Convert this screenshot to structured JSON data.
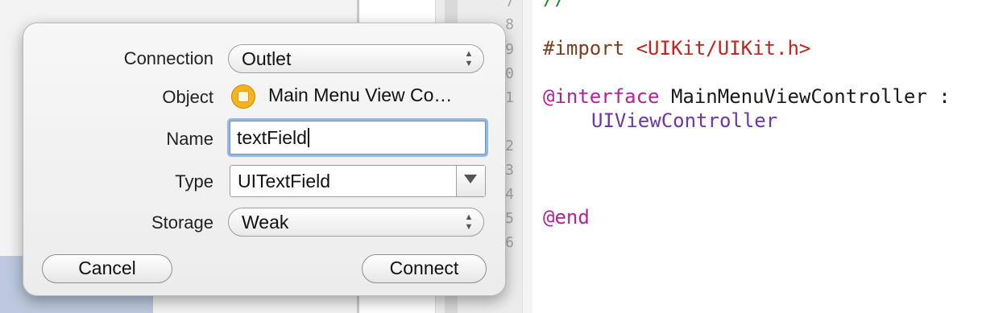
{
  "editor": {
    "line_numbers": [
      "7",
      "8",
      "9",
      "0",
      "1",
      "2",
      "3",
      "4",
      "5",
      "6"
    ],
    "code": {
      "comment": "//",
      "import_keyword": "#import",
      "import_path": "<UIKit/UIKit.h>",
      "interface_keyword": "@interface",
      "class_decl": " MainMenuViewController :",
      "superclass": "UIViewController",
      "end_keyword": "@end"
    }
  },
  "dialog": {
    "labels": {
      "connection": "Connection",
      "object": "Object",
      "name": "Name",
      "type": "Type",
      "storage": "Storage"
    },
    "connection_value": "Outlet",
    "object_value": "Main Menu View Co…",
    "name_value": "textField",
    "type_value": "UITextField",
    "storage_value": "Weak",
    "cancel_label": "Cancel",
    "connect_label": "Connect",
    "icons": {
      "updown": "updown-chevron-icon",
      "object": "view-controller-icon",
      "dropdown": "dropdown-arrow-icon"
    }
  }
}
